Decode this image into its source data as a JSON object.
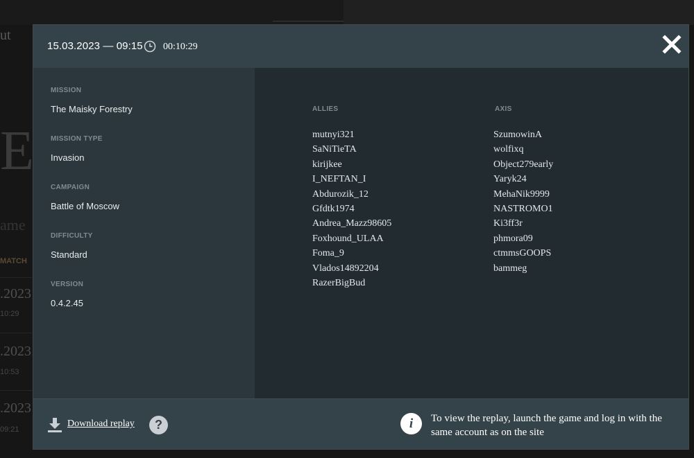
{
  "background": {
    "nav_fragment": "ut",
    "hero_letter": "E",
    "game_fragment": "ame",
    "match_header": "MATCH",
    "rows": [
      {
        "date": ".2023",
        "time": "10:29"
      },
      {
        "date": ".2023",
        "time": "10:53"
      },
      {
        "date": ".2023",
        "time": "09:21"
      }
    ]
  },
  "modal": {
    "header": {
      "datetime": "15.03.2023 — 09:15",
      "duration": "00:10:29",
      "close_icon": "close-icon"
    },
    "details": [
      {
        "label": "MISSION",
        "value": "The Maisky Forestry"
      },
      {
        "label": "MISSION TYPE",
        "value": "Invasion"
      },
      {
        "label": "CAMPAIGN",
        "value": "Battle of Moscow"
      },
      {
        "label": "DIFFICULTY",
        "value": "Standard"
      },
      {
        "label": "VERSION",
        "value": "0.4.2.45"
      }
    ],
    "teams": {
      "allies": {
        "title": "ALLIES",
        "players": [
          "mutnyi321",
          "SaNiTieTA",
          "kirijkee",
          "I_NEFTAN_I",
          "Abdurozik_12",
          "Gfdtk1974",
          "Andrea_Mazz98605",
          "Foxhound_ULAA",
          "Foma_9",
          "Vlados14892204",
          "RazerBigBud"
        ]
      },
      "axis": {
        "title": "AXIS",
        "players": [
          "SzumowinA",
          "wolfixq",
          "Object279early",
          "Yaryk24",
          "MehaNik9999",
          "NASTROMO1",
          "Ki3ff3r",
          "phmora09",
          "ctmmsGOOPS",
          "bammeg"
        ]
      }
    },
    "footer": {
      "download_label": "Download replay",
      "help_symbol": "?",
      "info_symbol": "i",
      "info_text": "To view the replay, launch the game and log in with the same account as on the site"
    }
  },
  "colors": {
    "header_bg": "#34434a",
    "left_panel_bg": "#2b373c",
    "body_bg": "#222c30",
    "label": "#7f8b90",
    "text": "#ffffff"
  }
}
